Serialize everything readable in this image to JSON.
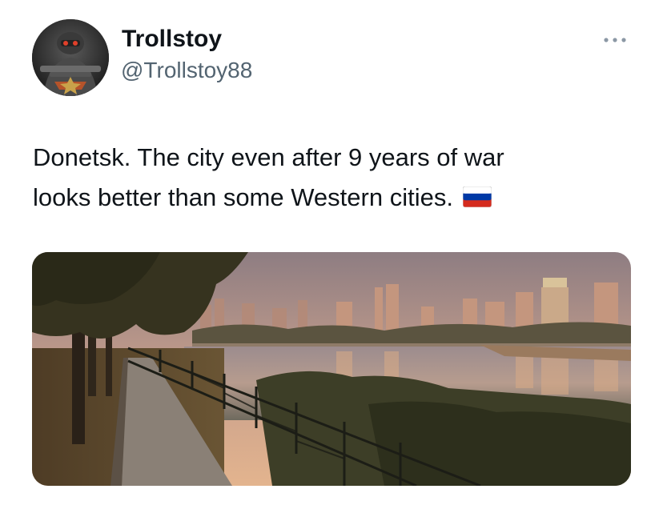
{
  "author": {
    "display_name": "Trollstoy",
    "handle": "@Trollstoy88",
    "avatar_icon": "soldier-avatar-icon"
  },
  "tweet": {
    "text_line_1": "Donetsk. The city even after 9 years of war",
    "text_line_2": "looks better than some Western cities.",
    "emoji": "russian-flag-icon"
  },
  "media": {
    "type": "photo",
    "subject": "city-panorama-photo"
  },
  "icons": {
    "more": "more-dots-icon"
  },
  "colors": {
    "text_primary": "#0f1419",
    "text_secondary": "#536471",
    "background": "#ffffff"
  }
}
